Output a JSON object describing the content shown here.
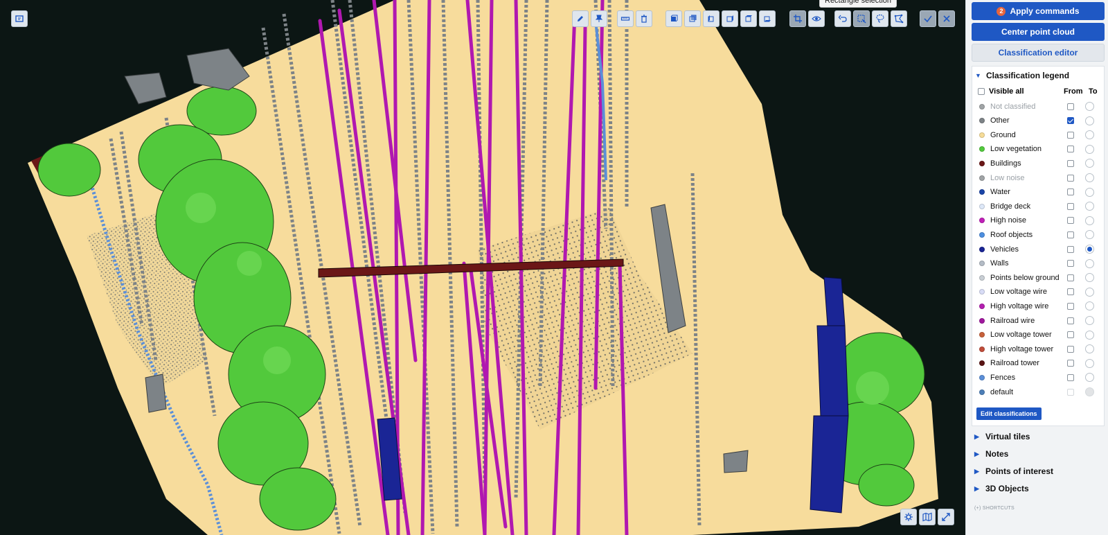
{
  "viewport": {
    "tooltip": "Rectangle selection",
    "toolbar": [
      {
        "name": "pencil-icon",
        "label": "edit"
      },
      {
        "name": "pin-icon",
        "label": "pin"
      },
      {
        "name": "ruler-icon",
        "label": "measure"
      },
      {
        "name": "trash-icon",
        "label": "delete"
      },
      {
        "name": "cube-front-icon",
        "label": "view front"
      },
      {
        "name": "cube-back-icon",
        "label": "view back"
      },
      {
        "name": "cube-left-icon",
        "label": "view left"
      },
      {
        "name": "cube-right-icon",
        "label": "view right"
      },
      {
        "name": "cube-top-icon",
        "label": "view top"
      },
      {
        "name": "cube-bottom-icon",
        "label": "view bottom"
      },
      {
        "name": "crop-icon",
        "label": "crop"
      },
      {
        "name": "eye-icon",
        "label": "visibility"
      },
      {
        "name": "undo-icon",
        "label": "undo"
      },
      {
        "name": "rectangle-select-icon",
        "label": "rectangle selection"
      },
      {
        "name": "lasso-select-icon",
        "label": "lasso selection"
      },
      {
        "name": "polygon-select-icon",
        "label": "polygon selection"
      },
      {
        "name": "confirm-icon",
        "label": "confirm"
      },
      {
        "name": "close-icon",
        "label": "cancel"
      }
    ],
    "corner_buttons": [
      "settings-icon",
      "map-icon",
      "fullscreen-icon"
    ]
  },
  "sidebar": {
    "apply_label": "Apply commands",
    "apply_badge": "2",
    "center_label": "Center point cloud",
    "editor_label": "Classification editor",
    "legend_title": "Classification legend",
    "visible_all": "Visible all",
    "col_from": "From",
    "col_to": "To",
    "classes": [
      {
        "name": "Not classified",
        "color": "#a0a4a6",
        "dim": true,
        "from": false,
        "to": false
      },
      {
        "name": "Other",
        "color": "#7d8387",
        "dim": false,
        "from": true,
        "to": false
      },
      {
        "name": "Ground",
        "color": "#f6dc98",
        "dim": false,
        "from": false,
        "to": false
      },
      {
        "name": "Low vegetation",
        "color": "#52c93c",
        "dim": false,
        "from": false,
        "to": false
      },
      {
        "name": "Buildings",
        "color": "#6b1717",
        "dim": false,
        "from": false,
        "to": false
      },
      {
        "name": "Low noise",
        "color": "#a0a4a6",
        "dim": true,
        "from": false,
        "to": false
      },
      {
        "name": "Water",
        "color": "#1b45a8",
        "dim": false,
        "from": false,
        "to": false
      },
      {
        "name": "Bridge deck",
        "color": "#dde8f8",
        "dim": false,
        "from": false,
        "to": false
      },
      {
        "name": "High noise",
        "color": "#c020b8",
        "dim": false,
        "from": false,
        "to": false
      },
      {
        "name": "Roof objects",
        "color": "#4d8fe0",
        "dim": false,
        "from": false,
        "to": false
      },
      {
        "name": "Vehicles",
        "color": "#1a2595",
        "dim": false,
        "from": false,
        "to": true
      },
      {
        "name": "Walls",
        "color": "#b4bcc6",
        "dim": false,
        "from": false,
        "to": false
      },
      {
        "name": "Points below ground",
        "color": "#c8ced4",
        "dim": false,
        "from": false,
        "to": false
      },
      {
        "name": "Low voltage wire",
        "color": "#d8dcf6",
        "dim": false,
        "from": false,
        "to": false
      },
      {
        "name": "High voltage wire",
        "color": "#b41fb0",
        "dim": false,
        "from": false,
        "to": false
      },
      {
        "name": "Railroad wire",
        "color": "#a0189e",
        "dim": false,
        "from": false,
        "to": false
      },
      {
        "name": "Low voltage tower",
        "color": "#c8613a",
        "dim": false,
        "from": false,
        "to": false
      },
      {
        "name": "High voltage tower",
        "color": "#c04d3a",
        "dim": false,
        "from": false,
        "to": false
      },
      {
        "name": "Railroad tower",
        "color": "#5a1414",
        "dim": false,
        "from": false,
        "to": false
      },
      {
        "name": "Fences",
        "color": "#5b8fd8",
        "dim": false,
        "from": false,
        "to": false
      },
      {
        "name": "default",
        "color": "#4d7fb8",
        "dim": false,
        "from": false,
        "to": false,
        "disabled": true
      }
    ],
    "edit_label": "Edit classifications",
    "sections": [
      "Virtual tiles",
      "Notes",
      "Points of interest",
      "3D Objects"
    ],
    "shortcuts": "(+) SHORTCUTS"
  }
}
